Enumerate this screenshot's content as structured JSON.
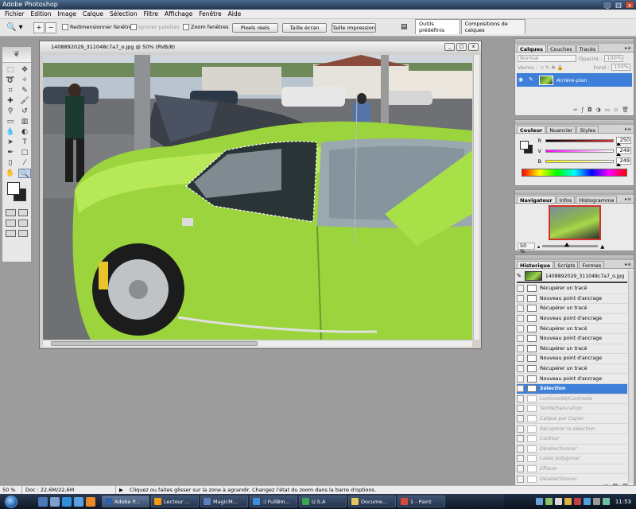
{
  "app": {
    "title": "Adobe Photoshop",
    "controls": {
      "minimize": "_",
      "maximize": "□",
      "close": "x"
    }
  },
  "menu": [
    "Fichier",
    "Edition",
    "Image",
    "Calque",
    "Sélection",
    "Filtre",
    "Affichage",
    "Fenêtre",
    "Aide"
  ],
  "options": {
    "tool_icon": "zoom-tool-icon",
    "resize_windows": "Redimensionner fenêtres",
    "ignore_palettes": "Ignorer palettes",
    "zoom_windows": "Zoom fenêtres",
    "actual_pixels": "Pixels réels",
    "fit_screen": "Taille écran",
    "print_size": "Taille impression",
    "wells": [
      "Outils prédéfinis",
      "Compositions de calques"
    ]
  },
  "document": {
    "title": "1408892029_311048c7a7_o.jpg @ 50% (RVB/8)"
  },
  "layers_panel": {
    "tabs": [
      "Calques",
      "Couches",
      "Tracés"
    ],
    "blend_mode": "Normal",
    "opacity_label": "Opacité :",
    "opacity": "100%",
    "lock_label": "Verrou :",
    "fill_label": "Fond :",
    "fill": "100%",
    "layer_name": "Arrière-plan"
  },
  "color_panel": {
    "tabs": [
      "Couleur",
      "Nuancier",
      "Styles"
    ],
    "channels": [
      {
        "label": "R",
        "value": "250",
        "color": "#e03030"
      },
      {
        "label": "V",
        "value": "249",
        "color": "#30c030"
      },
      {
        "label": "B",
        "value": "249",
        "color": "#3050e0"
      }
    ]
  },
  "navigator_panel": {
    "tabs": [
      "Navigateur",
      "Infos",
      "Histogramme"
    ],
    "zoom": "50 %"
  },
  "history_panel": {
    "tabs": [
      "Historique",
      "Scripts",
      "Formes"
    ],
    "snapshot": "1408892029_311048c7a7_o.jpg",
    "items": [
      {
        "label": "Récupérer un tracé",
        "state": "done"
      },
      {
        "label": "Nouveau point d'ancrage",
        "state": "done"
      },
      {
        "label": "Récupérer un tracé",
        "state": "done"
      },
      {
        "label": "Nouveau point d'ancrage",
        "state": "done"
      },
      {
        "label": "Récupérer un tracé",
        "state": "done"
      },
      {
        "label": "Nouveau point d'ancrage",
        "state": "done"
      },
      {
        "label": "Récupérer un tracé",
        "state": "done"
      },
      {
        "label": "Nouveau point d'ancrage",
        "state": "done"
      },
      {
        "label": "Récupérer un tracé",
        "state": "done"
      },
      {
        "label": "Nouveau point d'ancrage",
        "state": "done"
      },
      {
        "label": "Sélection",
        "state": "selected"
      },
      {
        "label": "Luminosité/Contraste",
        "state": "undone"
      },
      {
        "label": "Teinte/Saturation",
        "state": "undone"
      },
      {
        "label": "Calque par Copier",
        "state": "undone"
      },
      {
        "label": "Récupérer la sélection",
        "state": "undone"
      },
      {
        "label": "Contour",
        "state": "undone"
      },
      {
        "label": "Désélectionner",
        "state": "undone"
      },
      {
        "label": "Lasso polygonal",
        "state": "undone"
      },
      {
        "label": "Effacer",
        "state": "undone"
      },
      {
        "label": "Désélectionner",
        "state": "undone"
      }
    ]
  },
  "status": {
    "zoom": "50 %",
    "doc": "Doc : 22,6M/22,6M",
    "hint": "Cliquez ou faites glisser sur la zone à agrandir. Changez l'état du zoom dans la barre d'options."
  },
  "taskbar": {
    "tasks": [
      {
        "label": "Adobe P...",
        "color": "#2f5fa8"
      },
      {
        "label": "Lecteur ...",
        "color": "#f39c12"
      },
      {
        "label": "MagicM...",
        "color": "#5b7fbf"
      },
      {
        "label": ":) FullBm...",
        "color": "#3a8fd8"
      },
      {
        "label": "U.S.A",
        "color": "#3aa64f"
      },
      {
        "label": "Docume...",
        "color": "#e8c560"
      },
      {
        "label": "1 - Paint",
        "color": "#d94a3a"
      }
    ],
    "clock": "11:53"
  }
}
